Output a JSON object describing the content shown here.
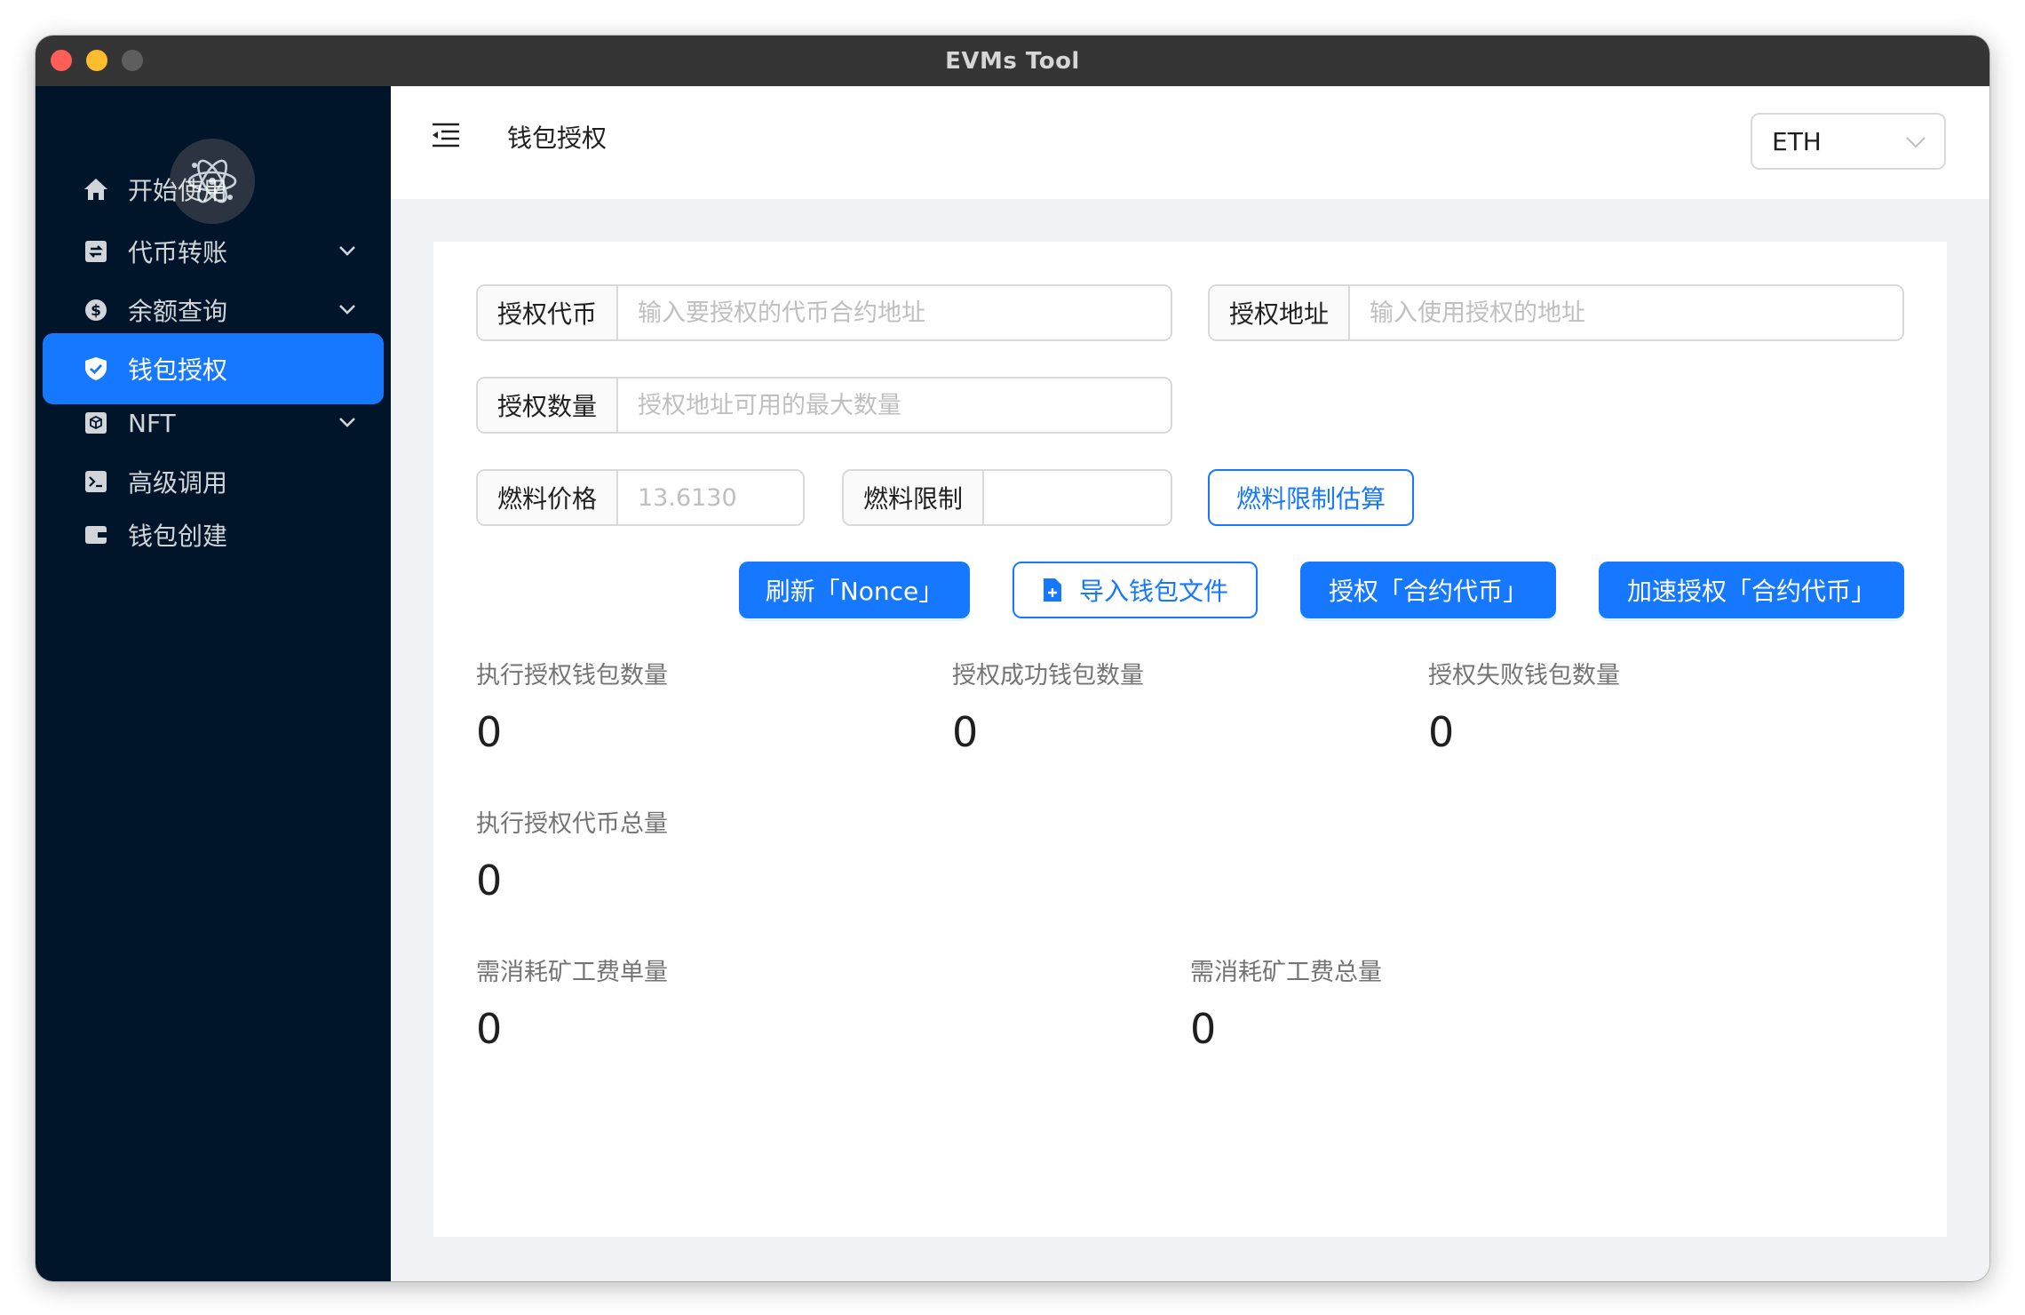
{
  "window": {
    "title": "EVMs Tool"
  },
  "sidebar": {
    "items": [
      {
        "label": "开始使用",
        "icon": "home-icon",
        "expandable": false,
        "active": false
      },
      {
        "label": "代币转账",
        "icon": "transfer-icon",
        "expandable": true,
        "active": false
      },
      {
        "label": "余额查询",
        "icon": "dollar-icon",
        "expandable": true,
        "active": false
      },
      {
        "label": "钱包授权",
        "icon": "shield-check-icon",
        "expandable": false,
        "active": true
      },
      {
        "label": "NFT",
        "icon": "cube-icon",
        "expandable": true,
        "active": false
      },
      {
        "label": "高级调用",
        "icon": "terminal-icon",
        "expandable": false,
        "active": false
      },
      {
        "label": "钱包创建",
        "icon": "wallet-icon",
        "expandable": false,
        "active": false
      }
    ]
  },
  "header": {
    "title": "钱包授权",
    "chain_select": {
      "value": "ETH"
    }
  },
  "form": {
    "token": {
      "label": "授权代币",
      "placeholder": "输入要授权的代币合约地址",
      "value": ""
    },
    "spender": {
      "label": "授权地址",
      "placeholder": "输入使用授权的地址",
      "value": ""
    },
    "amount": {
      "label": "授权数量",
      "placeholder": "授权地址可用的最大数量",
      "value": ""
    },
    "gas_price": {
      "label": "燃料价格",
      "placeholder": "13.6130",
      "value": ""
    },
    "gas_limit": {
      "label": "燃料限制",
      "placeholder": "",
      "value": ""
    },
    "estimate_button": "燃料限制估算"
  },
  "actions": {
    "refresh_nonce": "刷新「Nonce」",
    "import_wallet": "导入钱包文件",
    "approve": "授权「合约代币」",
    "speed_up": "加速授权「合约代币」"
  },
  "stats": {
    "exec_wallets": {
      "label": "执行授权钱包数量",
      "value": "0"
    },
    "success_wallets": {
      "label": "授权成功钱包数量",
      "value": "0"
    },
    "failed_wallets": {
      "label": "授权失败钱包数量",
      "value": "0"
    },
    "total_tokens": {
      "label": "执行授权代币总量",
      "value": "0"
    },
    "fee_per": {
      "label": "需消耗矿工费单量",
      "value": "0"
    },
    "fee_total": {
      "label": "需消耗矿工费总量",
      "value": "0"
    }
  },
  "colors": {
    "sidebar_bg": "#001529",
    "accent": "#1677ff",
    "title_bar": "#353535"
  }
}
